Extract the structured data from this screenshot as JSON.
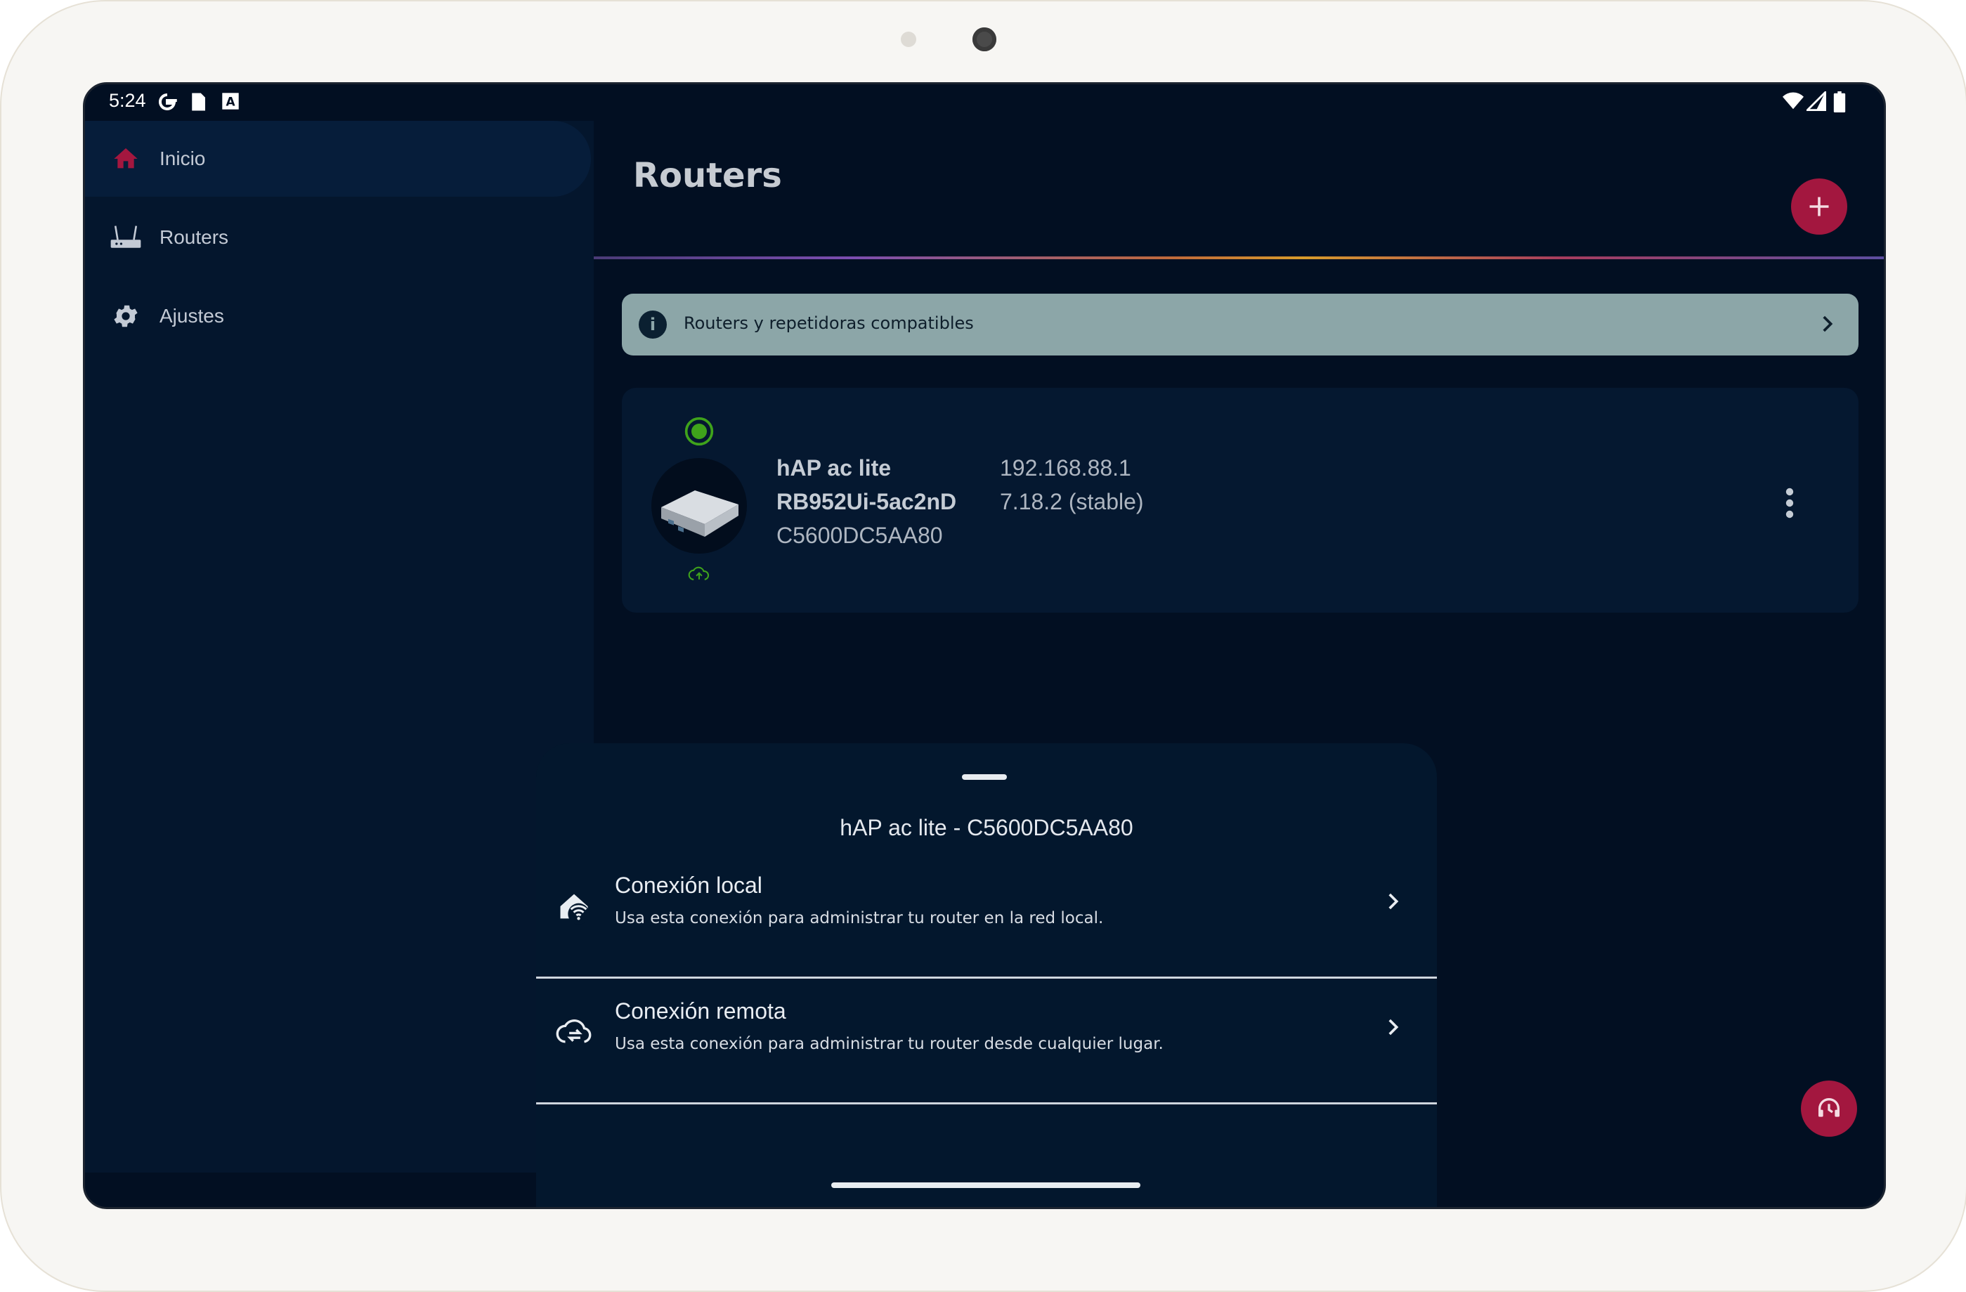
{
  "status_bar": {
    "time": "5:24"
  },
  "sidebar": {
    "items": [
      {
        "label": "Inicio",
        "icon": "home-icon",
        "active": true
      },
      {
        "label": "Routers",
        "icon": "router-icon",
        "active": false
      },
      {
        "label": "Ajustes",
        "icon": "gear-icon",
        "active": false
      }
    ]
  },
  "header": {
    "title": "Routers",
    "add_icon": "plus-icon"
  },
  "banner": {
    "text": "Routers y repetidoras compatibles",
    "icon": "info-icon"
  },
  "router": {
    "name": "hAP ac lite",
    "model": "RB952Ui-5ac2nD",
    "serial": "C5600DC5AA80",
    "ip": "192.168.88.1",
    "version": "7.18.2 (stable)",
    "status_color": "#3fa31b"
  },
  "sheet": {
    "title": "hAP ac lite - C5600DC5AA80",
    "options": [
      {
        "title": "Conexión local",
        "subtitle": "Usa esta conexión para administrar tu router en la red local.",
        "icon": "home-wifi-icon"
      },
      {
        "title": "Conexión remota",
        "subtitle": "Usa esta conexión para administrar tu router desde cualquier lugar.",
        "icon": "cloud-sync-icon"
      }
    ]
  },
  "colors": {
    "accent": "#a3173f",
    "background": "#020f22",
    "banner": "#8ca6a8"
  }
}
